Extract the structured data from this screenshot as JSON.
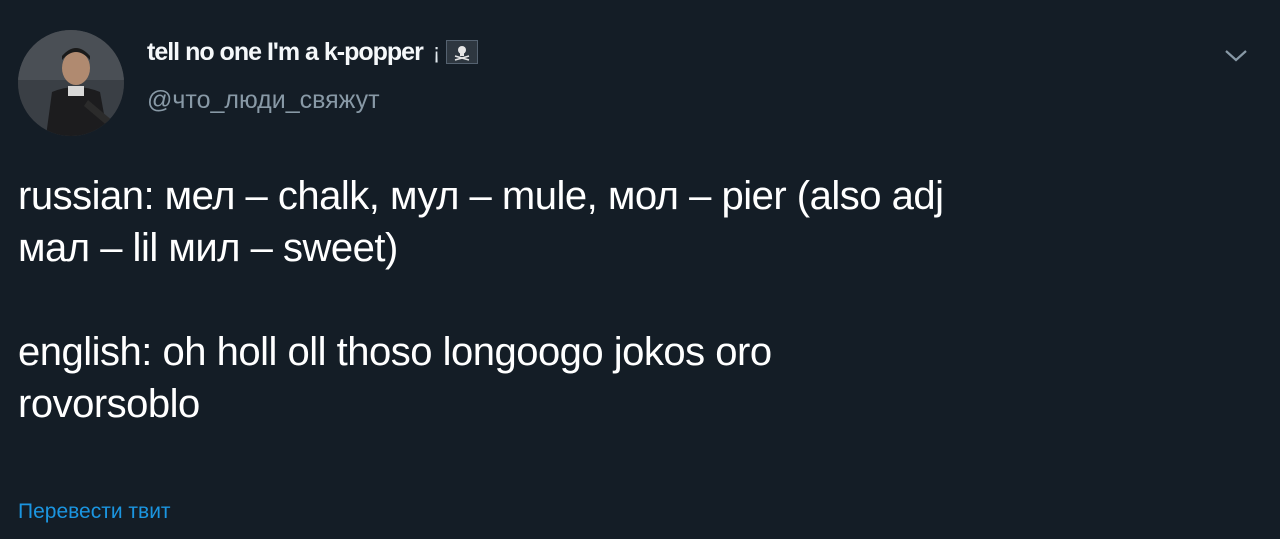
{
  "author": {
    "display_name": "tell no one I'm a k-popper",
    "name_suffix": "¡",
    "handle": "@что_люди_свяжут",
    "avatar_icon": "avatar-photo",
    "flag_icon": "pirate-flag-icon"
  },
  "tweet": {
    "lines_para1": [
      "russian: мел – chalk, мул – mule, мол – pier (also adj",
      "мал – lil мил – sweet)"
    ],
    "lines_para2": [
      "english: oh holl oll thoso longoogo jokos oro",
      "rovorsoblo"
    ],
    "translate_label": "Перевести твит"
  },
  "menu": {
    "chevron_icon": "chevron-down-icon"
  },
  "colors": {
    "background": "#141d26",
    "text": "#ffffff",
    "secondary": "#8899a6",
    "link": "#1b95e0"
  }
}
